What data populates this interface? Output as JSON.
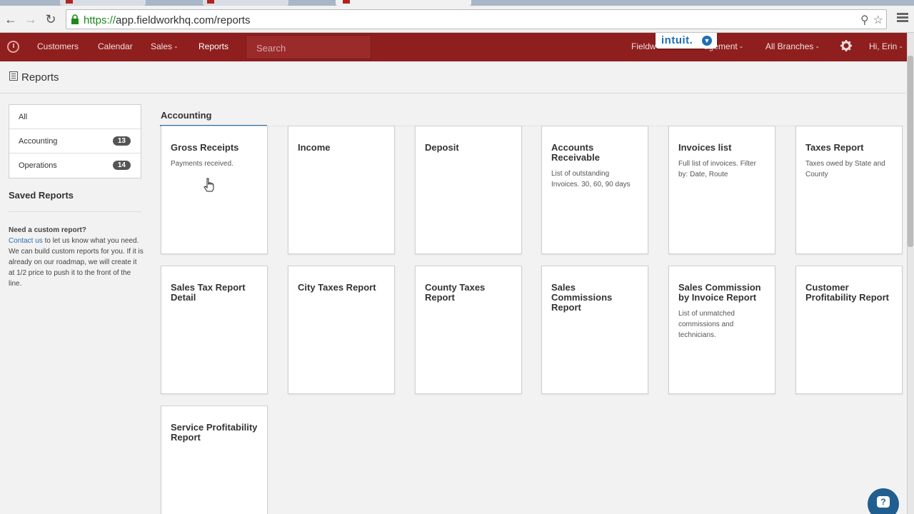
{
  "browser": {
    "url_protocol": "https://",
    "url_rest": "app.fieldworkhq.com/reports"
  },
  "appnav": {
    "items": [
      {
        "label": "Customers"
      },
      {
        "label": "Calendar"
      },
      {
        "label": "Sales -"
      },
      {
        "label": "Reports"
      },
      {
        "label": "Fieldw"
      },
      {
        "label": "agement -"
      },
      {
        "label": "All Branches -"
      },
      {
        "label": "Hi, Erin -"
      }
    ],
    "search_placeholder": "Search",
    "intuit_label": "intuit."
  },
  "page": {
    "title": "Reports"
  },
  "sidebar": {
    "filters": [
      {
        "label": "All",
        "count": ""
      },
      {
        "label": "Accounting",
        "count": "13"
      },
      {
        "label": "Operations",
        "count": "14"
      }
    ],
    "saved_title": "Saved Reports",
    "note_heading": "Need a custom report?",
    "note_link": "Contact us",
    "note_body": " to let us know what you need. We can build custom reports for you. If it is already on our roadmap, we will create it at 1/2 price to push it to the front of the line."
  },
  "section": {
    "title": "Accounting"
  },
  "cards": [
    {
      "name": "Gross Receipts",
      "desc": "Payments received."
    },
    {
      "name": "Income",
      "desc": ""
    },
    {
      "name": "Deposit",
      "desc": ""
    },
    {
      "name": "Accounts Receivable",
      "desc": "List of outstanding Invoices. 30, 60, 90 days"
    },
    {
      "name": "Invoices list",
      "desc": "Full list of invoices. Filter by: Date, Route"
    },
    {
      "name": "Taxes Report",
      "desc": "Taxes owed by State and County"
    },
    {
      "name": "Sales Tax Report Detail",
      "desc": ""
    },
    {
      "name": "City Taxes Report",
      "desc": ""
    },
    {
      "name": "County Taxes Report",
      "desc": ""
    },
    {
      "name": "Sales Commissions Report",
      "desc": ""
    },
    {
      "name": "Sales Commission by Invoice Report",
      "desc": "List of unmatched commissions and technicians."
    },
    {
      "name": "Customer Profitability Report",
      "desc": ""
    },
    {
      "name": "Service Profitability Report",
      "desc": ""
    }
  ]
}
